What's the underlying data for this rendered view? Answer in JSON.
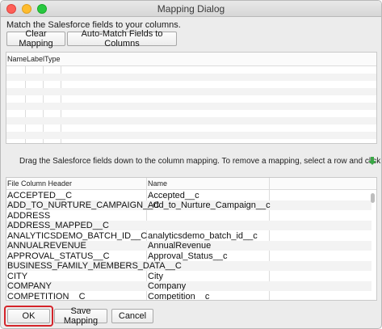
{
  "window": {
    "title": "Mapping Dialog"
  },
  "instruction": "Match the Salesforce fields to your columns.",
  "toolbar": {
    "clear_label": "Clear Mapping",
    "auto_label": "Auto-Match Fields to Columns"
  },
  "fields_table": {
    "headers": [
      "Name",
      "Label",
      "Type"
    ]
  },
  "drag_hint": "Drag the Salesforce fields down to the column mapping.  To remove a mapping, select a row and click Delete.",
  "mapping_table": {
    "headers": [
      "File Column Header",
      "Name"
    ],
    "rows": [
      {
        "header": "ACCEPTED__C",
        "name": "Accepted__c"
      },
      {
        "header": "ADD_TO_NURTURE_CAMPAIGN__C",
        "name": "Add_to_Nurture_Campaign__c"
      },
      {
        "header": "ADDRESS",
        "name": ""
      },
      {
        "header": "ADDRESS_MAPPED__C",
        "name": ""
      },
      {
        "header": "ANALYTICSDEMO_BATCH_ID__C",
        "name": "analyticsdemo_batch_id__c"
      },
      {
        "header": "ANNUALREVENUE",
        "name": "AnnualRevenue"
      },
      {
        "header": "APPROVAL_STATUS__C",
        "name": "Approval_Status__c"
      },
      {
        "header": "BUSINESS_FAMILY_MEMBERS_DATA__C",
        "name": ""
      },
      {
        "header": "CITY",
        "name": "City"
      },
      {
        "header": "COMPANY",
        "name": "Company"
      },
      {
        "header": "COMPETITION__C",
        "name": "Competition__c"
      }
    ]
  },
  "footer": {
    "ok_label": "OK",
    "save_label": "Save Mapping",
    "cancel_label": "Cancel"
  },
  "colors": {
    "highlight": "#d4242a",
    "arrow": "#3aa846"
  }
}
